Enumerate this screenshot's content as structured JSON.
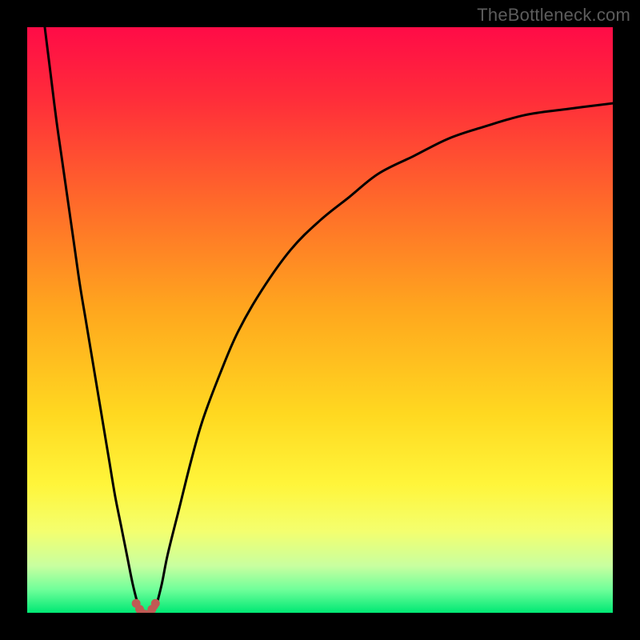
{
  "watermark": "TheBottleneck.com",
  "colors": {
    "black": "#000000",
    "curve": "#000000",
    "marker": "#c05a54",
    "gradient_stops": [
      {
        "offset": 0.0,
        "color": "#ff0b47"
      },
      {
        "offset": 0.12,
        "color": "#ff2c3a"
      },
      {
        "offset": 0.3,
        "color": "#ff6a2a"
      },
      {
        "offset": 0.48,
        "color": "#ffa61e"
      },
      {
        "offset": 0.66,
        "color": "#ffd820"
      },
      {
        "offset": 0.78,
        "color": "#fff53a"
      },
      {
        "offset": 0.86,
        "color": "#f4ff6e"
      },
      {
        "offset": 0.92,
        "color": "#c8ffa0"
      },
      {
        "offset": 0.96,
        "color": "#70ff9a"
      },
      {
        "offset": 1.0,
        "color": "#00e874"
      }
    ]
  },
  "chart_data": {
    "type": "line",
    "title": "",
    "xlabel": "",
    "ylabel": "",
    "xlim": [
      0,
      100
    ],
    "ylim": [
      0,
      100
    ],
    "notch_x": 20,
    "series": [
      {
        "name": "left-branch",
        "x": [
          3,
          4,
          5,
          6,
          7,
          8,
          9,
          10,
          11,
          12,
          13,
          14,
          15,
          16,
          17,
          18,
          19
        ],
        "y": [
          100,
          92,
          84,
          77,
          70,
          63,
          56,
          50,
          44,
          38,
          32,
          26,
          20,
          15,
          10,
          5,
          1
        ]
      },
      {
        "name": "right-branch",
        "x": [
          22,
          23,
          24,
          26,
          28,
          30,
          33,
          36,
          40,
          45,
          50,
          55,
          60,
          66,
          72,
          78,
          85,
          92,
          100
        ],
        "y": [
          1,
          5,
          10,
          18,
          26,
          33,
          41,
          48,
          55,
          62,
          67,
          71,
          75,
          78,
          81,
          83,
          85,
          86,
          87
        ]
      },
      {
        "name": "bottom-flat",
        "x": [
          19,
          20,
          21,
          22
        ],
        "y": [
          1,
          0.2,
          0.2,
          1
        ]
      }
    ],
    "markers": {
      "name": "notch-markers",
      "x": [
        18.6,
        19.2,
        21.3,
        21.9
      ],
      "y": [
        1.6,
        0.6,
        0.6,
        1.6
      ]
    }
  }
}
